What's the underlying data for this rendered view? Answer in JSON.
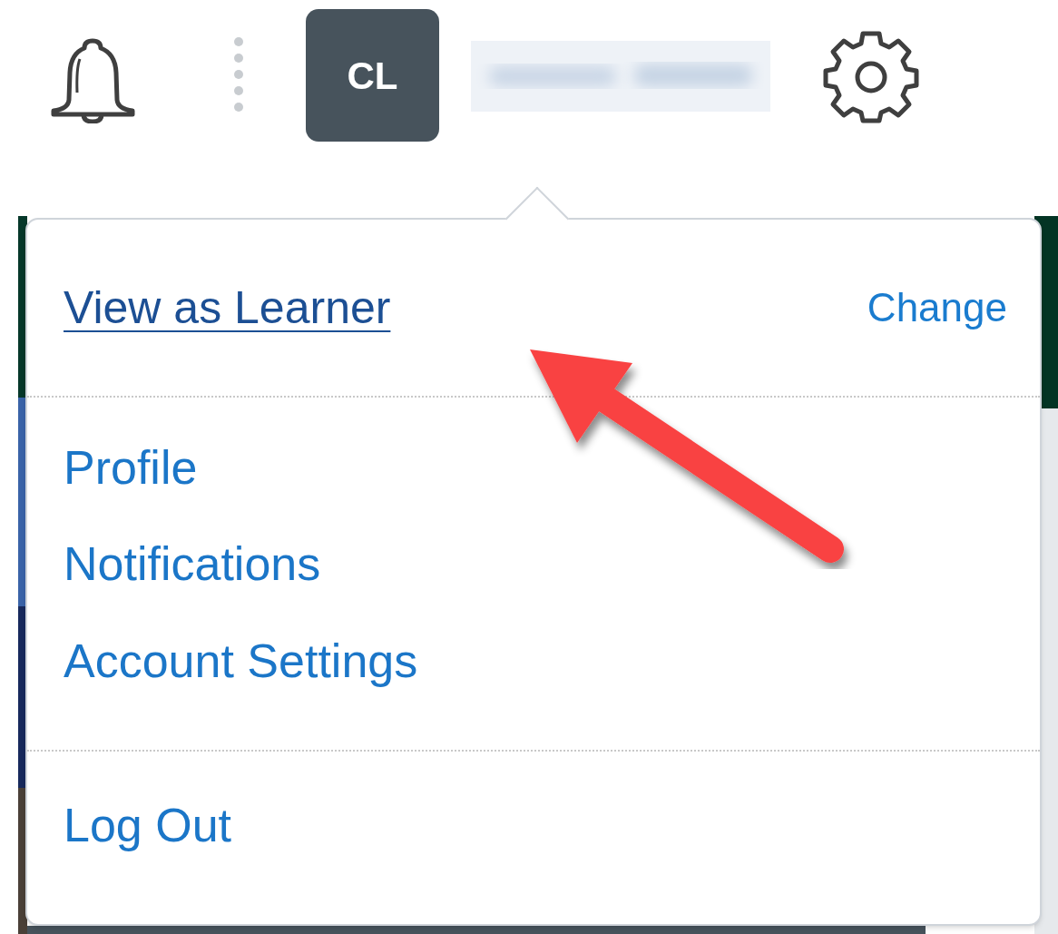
{
  "top_bar": {
    "avatar_initials": "CL"
  },
  "menu": {
    "header": {
      "link": "View as Learner",
      "action": "Change"
    },
    "items": [
      "Profile",
      "Notifications",
      "Account Settings"
    ],
    "footer": [
      "Log Out"
    ]
  }
}
